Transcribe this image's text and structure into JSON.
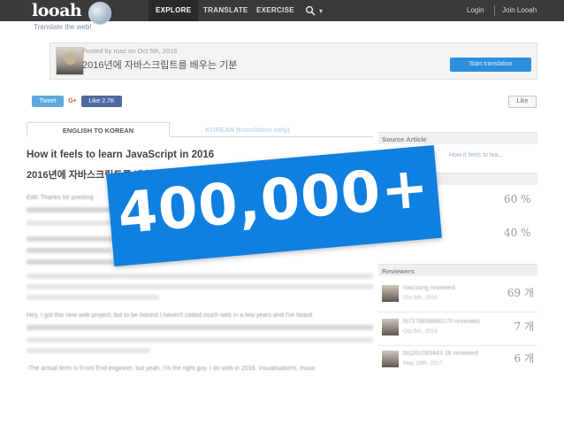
{
  "nav": {
    "logo": "looah",
    "tagline": "Translate the web!",
    "items": [
      "EXPLORE",
      "TRANSLATE",
      "EXERCISE"
    ],
    "login": "Login",
    "join": "Join Looah"
  },
  "post": {
    "posted_by": "Posted by roaz  on Oct 5th, 2016",
    "title": "2016년에 자바스크립트를 배우는 기분",
    "start_button": "Start translation"
  },
  "social": {
    "tweet": "Tweet",
    "gplus": "G+",
    "fb_like": "Like 2.7K",
    "like": "Like"
  },
  "tabs": {
    "english_to_korean": "ENGLISH TO KOREAN",
    "korean": "KOREAN (translation only)"
  },
  "article": {
    "title_en": "How it feels to learn JavaScript in 2016",
    "title_ko": "2016년에 자바스크립트를 배우는 기분",
    "edit_prefix": "Edit: Thanks for pointing",
    "para_hey": "Hey, I got this new web project, but to be honest I haven't coded much web in a few years and I've heard",
    "para_actual": "-The actual term is Front End engineer, but yeah, I'm the right guy. I do web in 2016. Visualisations, music"
  },
  "sidebar": {
    "source_article": "Source Article",
    "source_link": "How it feels to lea...",
    "reviewers": "Reviewers",
    "percentages": [
      "60 %",
      "40 %"
    ],
    "reviewer_list": [
      {
        "name": "roazzang reviewed",
        "date": "Oct 5th, 2016",
        "score": "69 개"
      },
      {
        "name": "fb7278838680170 reviewed",
        "date": "Oct 5th, 2016",
        "score": "7 개"
      },
      {
        "name": "fb1261093443 18 reviewed",
        "date": "May 18th, 2017",
        "score": "6 개"
      }
    ]
  },
  "banner": {
    "text": "400,000+",
    "color": "#0f7fe0"
  },
  "colors": {
    "navbar": "#3a3a3a",
    "accent": "#2b8fde"
  }
}
